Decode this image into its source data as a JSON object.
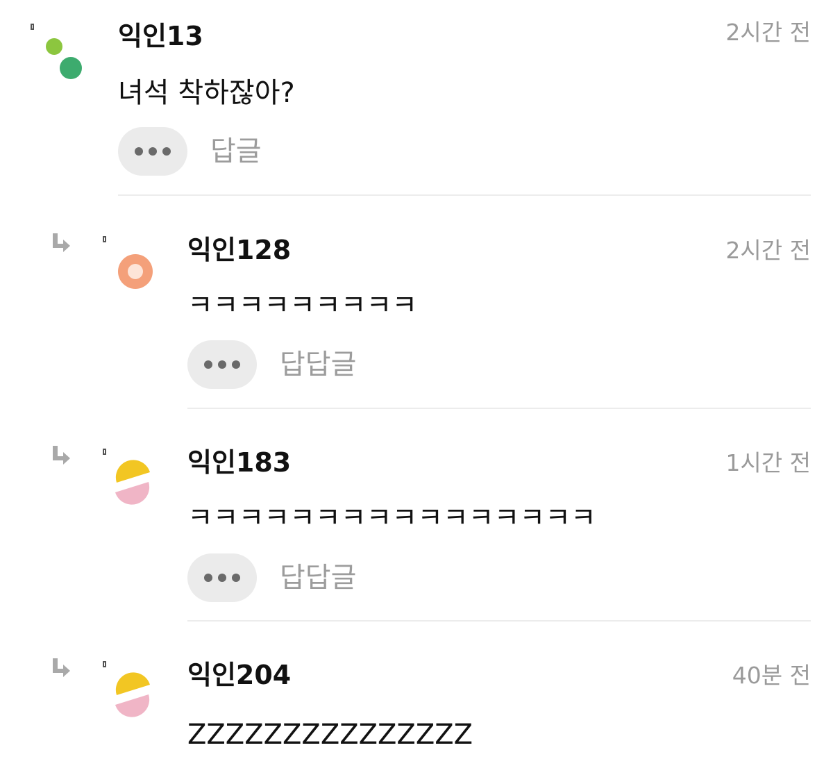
{
  "comments": [
    {
      "author": "익인13",
      "time": "2시간 전",
      "text": "녀석 착하잖아?",
      "reply_label": "답글",
      "avatar_icon": "green-dots-icon",
      "is_reply": false
    },
    {
      "author": "익인128",
      "time": "2시간 전",
      "text": "ㅋㅋㅋㅋㅋㅋㅋㅋㅋ",
      "reply_label": "답답글",
      "avatar_icon": "orange-ring-icon",
      "is_reply": true
    },
    {
      "author": "익인183",
      "time": "1시간 전",
      "text": "ㅋㅋㅋㅋㅋㅋㅋㅋㅋㅋㅋㅋㅋㅋㅋㅋ",
      "reply_label": "답답글",
      "avatar_icon": "yellow-pink-halves-icon",
      "is_reply": true
    },
    {
      "author": "익인204",
      "time": "40분 전",
      "text": "ZZZZZZZZZZZZZZZ",
      "avatar_icon": "yellow-pink-halves-icon",
      "is_reply": true
    }
  ],
  "colors": {
    "divider": "#ececec",
    "meta_text": "#9a9a9a",
    "button_bg": "#ebebeb"
  }
}
